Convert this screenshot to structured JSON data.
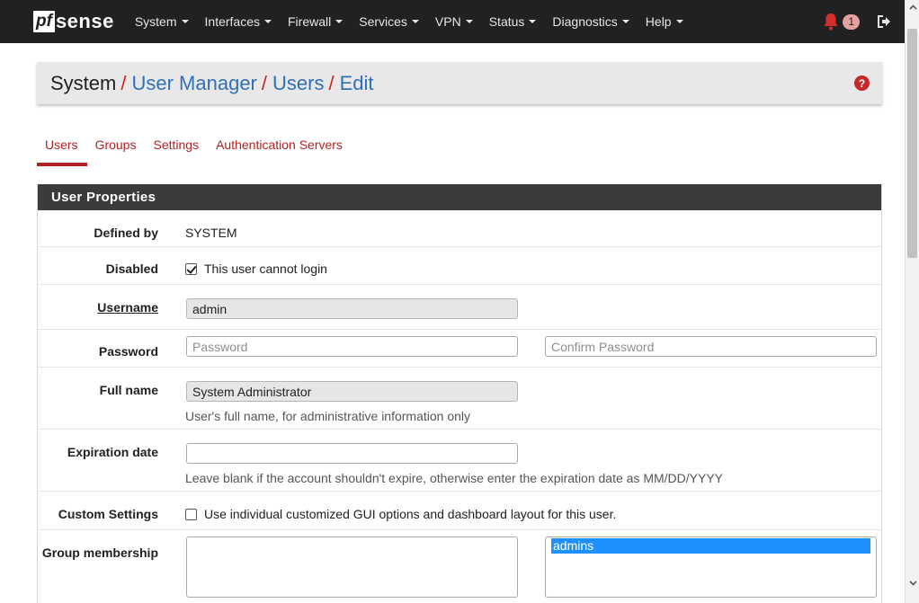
{
  "navbar": {
    "brand_box": "pf",
    "brand_text": "sense",
    "menus": [
      "System",
      "Interfaces",
      "Firewall",
      "Services",
      "VPN",
      "Status",
      "Diagnostics",
      "Help"
    ],
    "notification_count": "1"
  },
  "breadcrumb": {
    "root": "System",
    "items": [
      "User Manager",
      "Users",
      "Edit"
    ],
    "separator": "/"
  },
  "tabs": [
    "Users",
    "Groups",
    "Settings",
    "Authentication Servers"
  ],
  "active_tab": "Users",
  "panel": {
    "title": "User Properties",
    "defined_by": {
      "label": "Defined by",
      "value": "SYSTEM"
    },
    "disabled": {
      "label": "Disabled",
      "checkbox_label": "This user cannot login",
      "checked": true
    },
    "username": {
      "label": "Username",
      "value": "admin"
    },
    "password": {
      "label": "Password",
      "placeholder": "Password",
      "confirm_placeholder": "Confirm Password"
    },
    "fullname": {
      "label": "Full name",
      "value": "System Administrator",
      "help": "User's full name, for administrative information only"
    },
    "expiration": {
      "label": "Expiration date",
      "value": "",
      "help": "Leave blank if the account shouldn't expire, otherwise enter the expiration date as MM/DD/YYYY"
    },
    "custom_settings": {
      "label": "Custom Settings",
      "checkbox_label": "Use individual customized GUI options and dashboard layout for this user.",
      "checked": false
    },
    "group_membership": {
      "label": "Group membership",
      "available": [],
      "member_of": [
        "admins"
      ]
    }
  },
  "colors": {
    "accent": "#b22222",
    "link": "#3070b8",
    "navbar": "#212121",
    "panel_heading": "#3b3b3b",
    "selection": "#1e90ff"
  }
}
